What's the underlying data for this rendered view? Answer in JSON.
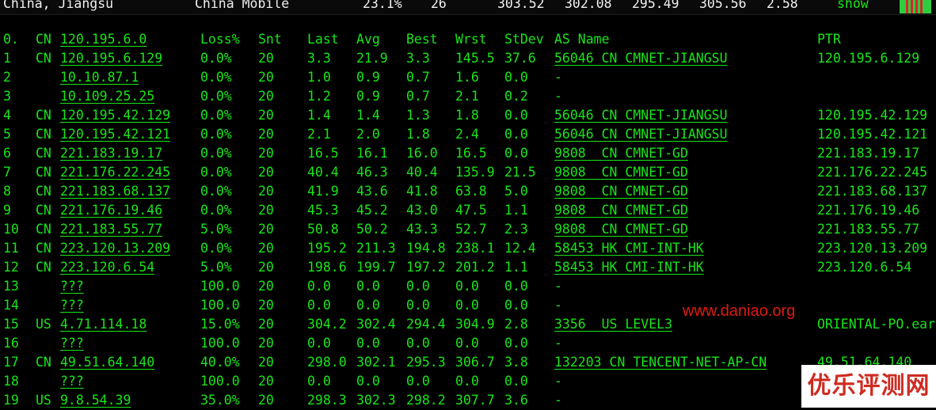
{
  "top_bar": {
    "location": "China, Jiangsu",
    "isp": "China Mobile",
    "loss": "23.1%",
    "snt": "26",
    "last": "303.52",
    "avg": "302.08",
    "best": "295.49",
    "wrst": "305.56",
    "stdev": "2.58",
    "show_label": "show"
  },
  "headers": [
    "0.",
    "CN",
    "120.195.6.0",
    "Loss%",
    "Snt",
    "Last",
    "Avg",
    "Best",
    "Wrst",
    "StDev",
    "AS Name",
    "PTR"
  ],
  "rows": [
    [
      "1",
      "CN",
      "120.195.6.129",
      "0.0%",
      "20",
      "3.3",
      "21.9",
      "3.3",
      "145.5",
      "37.6",
      "56046 CN CMNET-JIANGSU",
      "120.195.6.129"
    ],
    [
      "2",
      "",
      "10.10.87.1",
      "0.0%",
      "20",
      "1.0",
      "0.9",
      "0.7",
      "1.6",
      "0.0",
      "-",
      ""
    ],
    [
      "3",
      "",
      "10.109.25.25",
      "0.0%",
      "20",
      "1.2",
      "0.9",
      "0.7",
      "2.1",
      "0.2",
      "-",
      ""
    ],
    [
      "4",
      "CN",
      "120.195.42.129",
      "0.0%",
      "20",
      "1.4",
      "1.4",
      "1.3",
      "1.8",
      "0.0",
      "56046 CN CMNET-JIANGSU",
      "120.195.42.129"
    ],
    [
      "5",
      "CN",
      "120.195.42.121",
      "0.0%",
      "20",
      "2.1",
      "2.0",
      "1.8",
      "2.4",
      "0.0",
      "56046 CN CMNET-JIANGSU",
      "120.195.42.121"
    ],
    [
      "6",
      "CN",
      "221.183.19.17",
      "0.0%",
      "20",
      "16.5",
      "16.1",
      "16.0",
      "16.5",
      "0.0",
      "9808 CN CMNET-GD",
      "221.183.19.17"
    ],
    [
      "7",
      "CN",
      "221.176.22.245",
      "0.0%",
      "20",
      "40.4",
      "46.3",
      "40.4",
      "135.9",
      "21.5",
      "9808 CN CMNET-GD",
      "221.176.22.245"
    ],
    [
      "8",
      "CN",
      "221.183.68.137",
      "0.0%",
      "20",
      "41.9",
      "43.6",
      "41.8",
      "63.8",
      "5.0",
      "9808 CN CMNET-GD",
      "221.183.68.137"
    ],
    [
      "9",
      "CN",
      "221.176.19.46",
      "0.0%",
      "20",
      "45.3",
      "45.2",
      "43.0",
      "47.5",
      "1.1",
      "9808 CN CMNET-GD",
      "221.176.19.46"
    ],
    [
      "10",
      "CN",
      "221.183.55.77",
      "5.0%",
      "20",
      "50.8",
      "50.2",
      "43.3",
      "52.7",
      "2.3",
      "9808 CN CMNET-GD",
      "221.183.55.77"
    ],
    [
      "11",
      "CN",
      "223.120.13.209",
      "0.0%",
      "20",
      "195.2",
      "211.3",
      "194.8",
      "238.1",
      "12.4",
      "58453 HK CMI-INT-HK",
      "223.120.13.209"
    ],
    [
      "12",
      "CN",
      "223.120.6.54",
      "5.0%",
      "20",
      "198.6",
      "199.7",
      "197.2",
      "201.2",
      "1.1",
      "58453 HK CMI-INT-HK",
      "223.120.6.54"
    ],
    [
      "13",
      "",
      "???",
      "100.0",
      "20",
      "0.0",
      "0.0",
      "0.0",
      "0.0",
      "0.0",
      "-",
      ""
    ],
    [
      "14",
      "",
      "???",
      "100.0",
      "20",
      "0.0",
      "0.0",
      "0.0",
      "0.0",
      "0.0",
      "-",
      ""
    ],
    [
      "15",
      "US",
      "4.71.114.18",
      "15.0%",
      "20",
      "304.2",
      "302.4",
      "294.4",
      "304.9",
      "2.8",
      "3356 US LEVEL3",
      "ORIENTAL-PO.ear"
    ],
    [
      "16",
      "",
      "???",
      "100.0",
      "20",
      "0.0",
      "0.0",
      "0.0",
      "0.0",
      "0.0",
      "-",
      ""
    ],
    [
      "17",
      "CN",
      "49.51.64.140",
      "40.0%",
      "20",
      "298.0",
      "302.1",
      "295.3",
      "306.7",
      "3.8",
      "132203 CN TENCENT-NET-AP-CN",
      "49.51.64.140"
    ],
    [
      "18",
      "",
      "???",
      "100.0",
      "20",
      "0.0",
      "0.0",
      "0.0",
      "0.0",
      "0.0",
      "-",
      ""
    ],
    [
      "19",
      "US",
      "9.8.54.39",
      "35.0%",
      "20",
      "298.3",
      "302.3",
      "298.2",
      "307.7",
      "3.6",
      "-",
      ""
    ]
  ],
  "watermark_url": "www.daniao.org",
  "watermark_logo": "优乐评测网",
  "colors": {
    "background": "#000000",
    "text": "#19e419",
    "top_text": "#f0f0f0",
    "watermark": "#e01a12",
    "mini_graph_green": "#2ecc40",
    "mini_graph_red": "#d9262b"
  }
}
